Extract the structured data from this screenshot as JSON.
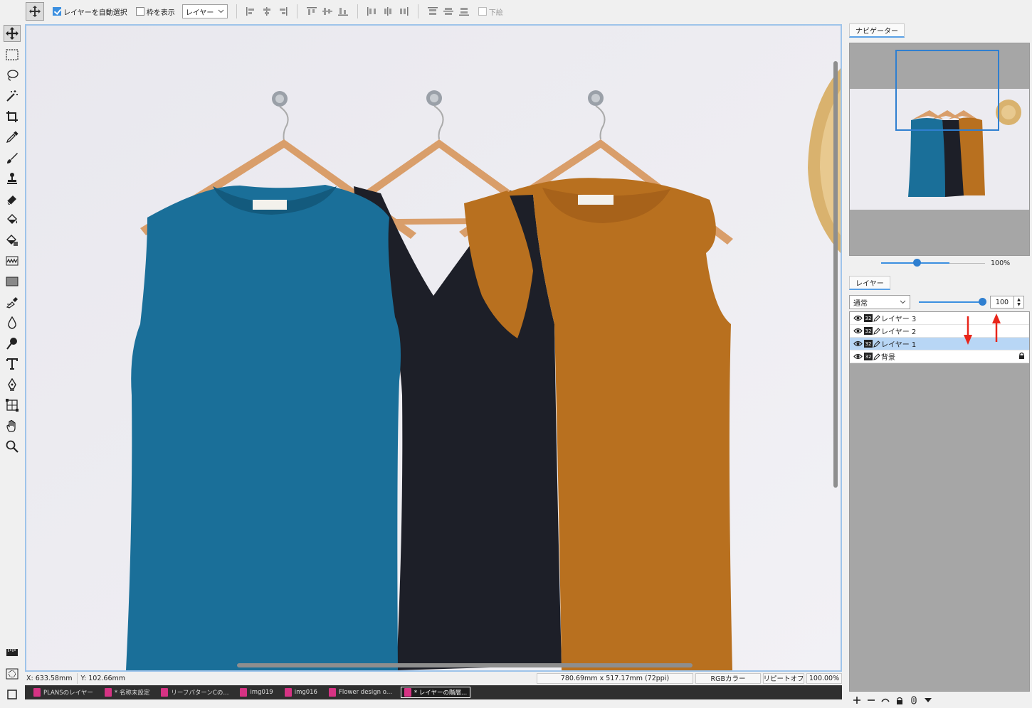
{
  "toolbar_options": {
    "auto_select_label": "レイヤーを自動選択",
    "auto_select_checked": true,
    "show_bounds_label": "枠を表示",
    "show_bounds_checked": false,
    "target_select": "レイヤー",
    "underlay_label": "下絵"
  },
  "tools": [
    {
      "name": "move-tool",
      "icon": "move-icon"
    },
    {
      "name": "rect-select-tool",
      "icon": "marquee-icon"
    },
    {
      "name": "lasso-tool",
      "icon": "lasso-icon"
    },
    {
      "name": "magic-wand-tool",
      "icon": "magic-wand-icon"
    },
    {
      "name": "crop-tool",
      "icon": "crop-icon"
    },
    {
      "name": "eyedropper-tool",
      "icon": "eyedropper-icon"
    },
    {
      "name": "brush-tool",
      "icon": "brush-icon"
    },
    {
      "name": "stamp-tool",
      "icon": "stamp-icon"
    },
    {
      "name": "eraser-tool",
      "icon": "eraser-icon"
    },
    {
      "name": "fill-tool",
      "icon": "bucket-icon"
    },
    {
      "name": "gradient-fill-tool",
      "icon": "bucket-gradient-icon"
    },
    {
      "name": "smudge-tool",
      "icon": "wave-icon"
    },
    {
      "name": "shape-tool",
      "icon": "rectangle-icon"
    },
    {
      "name": "clone-tool",
      "icon": "clone-icon"
    },
    {
      "name": "blur-tool",
      "icon": "drop-icon"
    },
    {
      "name": "dodge-tool",
      "icon": "dodge-icon"
    },
    {
      "name": "text-tool",
      "icon": "text-icon"
    },
    {
      "name": "pen-tool",
      "icon": "pen-nib-icon"
    },
    {
      "name": "transform-tool",
      "icon": "grid-icon"
    },
    {
      "name": "hand-tool",
      "icon": "hand-icon"
    },
    {
      "name": "zoom-tool",
      "icon": "magnifier-icon"
    }
  ],
  "status": {
    "x": "X:  633.58mm",
    "y": "Y:  102.66mm",
    "size": "780.69mm x 517.17mm (72ppi)",
    "color_mode": "RGBカラー",
    "repeat": "リピートオフ",
    "zoom": "100.00%"
  },
  "doc_tabs": [
    {
      "label": "PLANSのレイヤー",
      "active": false
    },
    {
      "label": "* 名称未設定",
      "active": false
    },
    {
      "label": "リーフパターンCの...",
      "active": false
    },
    {
      "label": "img019",
      "active": false
    },
    {
      "label": "img016",
      "active": false
    },
    {
      "label": "Flower design o...",
      "active": false
    },
    {
      "label": "* レイヤーの階層...",
      "active": true
    }
  ],
  "navigator": {
    "tab_label": "ナビゲーター",
    "zoom_label": "100%",
    "zoom_fraction": 0.52
  },
  "layers_panel": {
    "tab_label": "レイヤー",
    "blend_mode": "通常",
    "opacity": "100",
    "opacity_fraction": 1.0,
    "layers": [
      {
        "name": "レイヤー 3",
        "bits": "32",
        "selected": false,
        "locked": false
      },
      {
        "name": "レイヤー 2",
        "bits": "32",
        "selected": false,
        "locked": false
      },
      {
        "name": "レイヤー 1",
        "bits": "32",
        "selected": true,
        "locked": false
      },
      {
        "name": "背景",
        "bits": "32",
        "selected": false,
        "locked": true
      }
    ]
  },
  "colors": {
    "accent": "#3b8fe0",
    "selection": "#b8d6f5",
    "annotation_arrow": "#e8251a",
    "shirt_blue": "#1a6f99",
    "shirt_black": "#1d1f28",
    "shirt_orange": "#b8701f"
  }
}
